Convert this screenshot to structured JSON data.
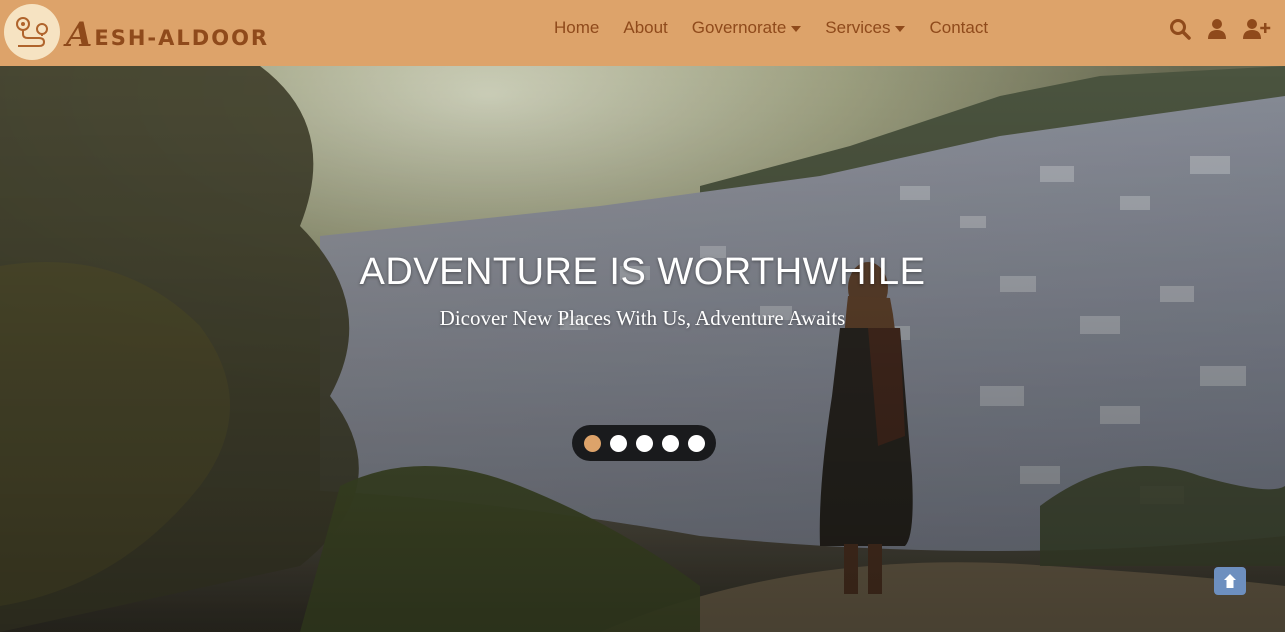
{
  "brand": {
    "first_letter": "A",
    "rest": "ESH-ALDOOR",
    "logo_icon": "map-route-icon"
  },
  "nav": {
    "items": [
      {
        "label": "Home",
        "dropdown": false
      },
      {
        "label": "About",
        "dropdown": false
      },
      {
        "label": "Governorate",
        "dropdown": true
      },
      {
        "label": "Services",
        "dropdown": true
      },
      {
        "label": "Contact",
        "dropdown": false
      }
    ],
    "icons": [
      "search-icon",
      "user-icon",
      "user-plus-icon"
    ]
  },
  "hero": {
    "title": "ADVENTURE IS WORTHWHILE",
    "subtitle": "Dicover New Places With Us, Adventure Awaits",
    "slides_total": 5,
    "active_slide": 1
  },
  "colors": {
    "nav_bg": "#dda36a",
    "brand_text": "#8f4a1b",
    "active_dot": "#dda36a",
    "scroll_top_bg": "#6d8fbf"
  }
}
